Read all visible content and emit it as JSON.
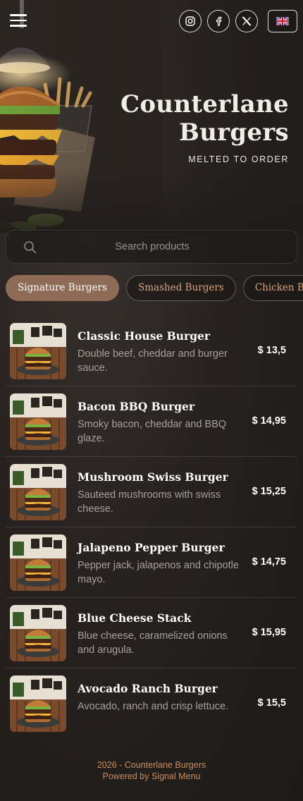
{
  "header": {
    "brand_line1": "Counterlane",
    "brand_line2": "Burgers",
    "tagline": "MELTED TO ORDER",
    "socials": [
      {
        "icon": "instagram-icon"
      },
      {
        "icon": "facebook-icon"
      },
      {
        "icon": "x-twitter-icon"
      }
    ],
    "language_icon": "uk-flag-icon"
  },
  "search": {
    "placeholder": "Search products"
  },
  "tabs": [
    {
      "label": "Signature Burgers",
      "active": true
    },
    {
      "label": "Smashed Burgers",
      "active": false
    },
    {
      "label": "Chicken Burgers",
      "active": false
    }
  ],
  "products": [
    {
      "name": "Classic House Burger",
      "description": "Double beef, cheddar and burger sauce.",
      "price": "$ 13,5"
    },
    {
      "name": "Bacon BBQ Burger",
      "description": "Smoky bacon, cheddar and BBQ glaze.",
      "price": "$ 14,95"
    },
    {
      "name": "Mushroom Swiss Burger",
      "description": "Sauteed mushrooms with swiss cheese.",
      "price": "$ 15,25"
    },
    {
      "name": "Jalapeno Pepper Burger",
      "description": "Pepper jack, jalapenos and chipotle mayo.",
      "price": "$ 14,75"
    },
    {
      "name": "Blue Cheese Stack",
      "description": "Blue cheese, caramelized onions and arugula.",
      "price": "$ 15,95"
    },
    {
      "name": "Avocado Ranch Burger",
      "description": "Avocado, ranch and crisp lettuce.",
      "price": "$ 15,5"
    }
  ],
  "footer": {
    "copyright": "2026 - Counterlane Burgers",
    "powered_by": "Powered by Signal Menu"
  },
  "colors": {
    "accent": "#8d6b55",
    "tab_text": "#d9a27a",
    "footer_text": "#c98d5c",
    "background": "#1f1b19"
  }
}
